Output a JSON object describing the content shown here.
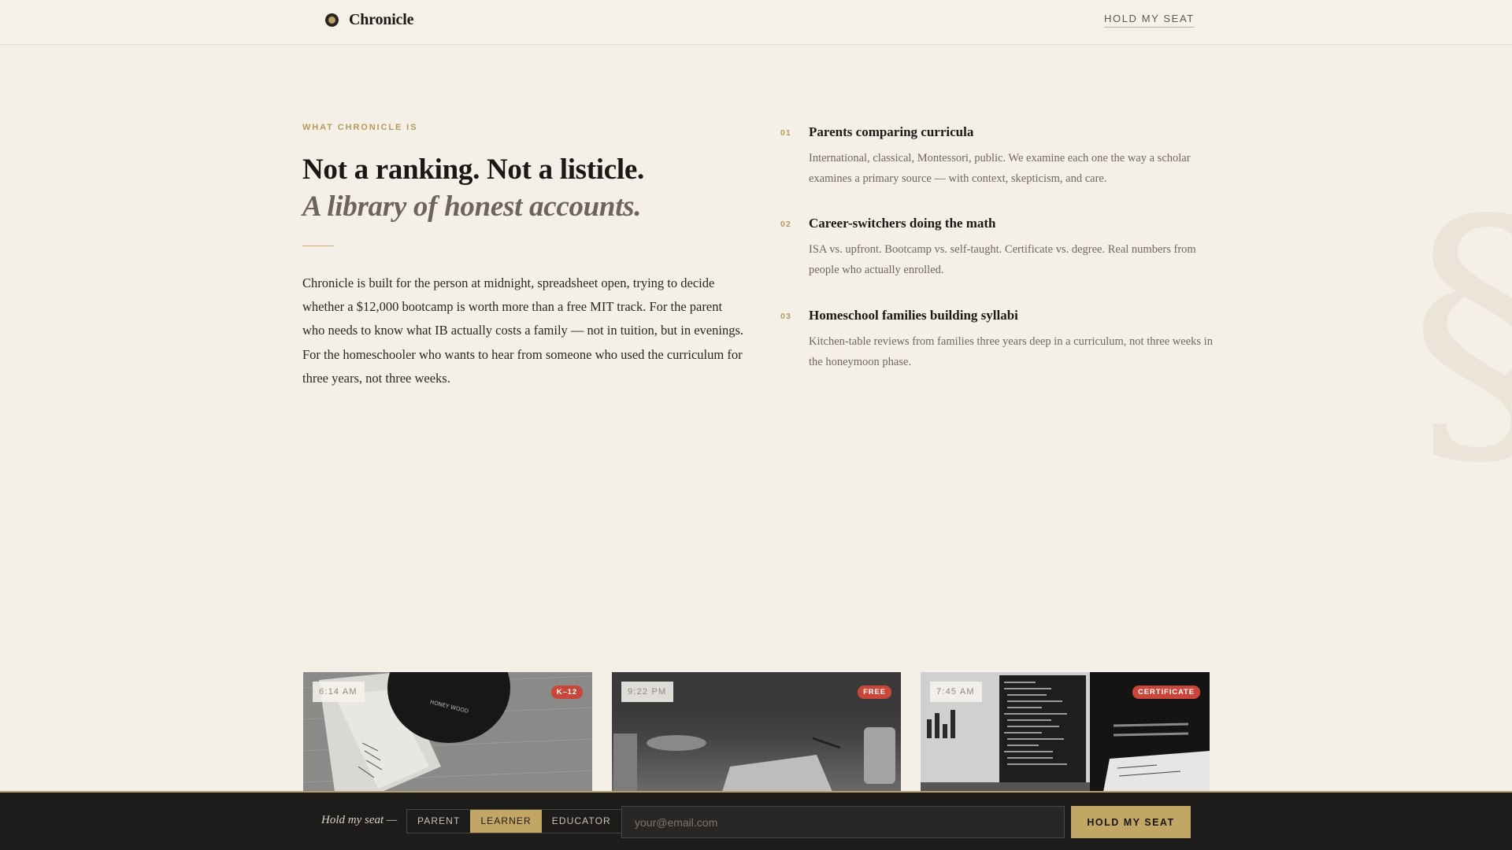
{
  "header": {
    "brand_name": "Chronicle",
    "cta_label": "HOLD MY SEAT"
  },
  "intro": {
    "eyebrow": "WHAT CHRONICLE IS",
    "title": "Not a ranking. Not a listicle.",
    "subtitle": "A library of honest accounts.",
    "body": "Chronicle is built for the person at midnight, spreadsheet open, trying to decide whether a $12,000 bootcamp is worth more than a free MIT track. For the parent who needs to know what IB actually costs a family — not in tuition, but in evenings. For the homeschooler who wants to hear from someone who used the curriculum for three years, not three weeks."
  },
  "audiences": [
    {
      "number": "01",
      "title": "Parents comparing curricula",
      "description": "International, classical, Montessori, public. We examine each one the way a scholar examines a primary source — with context, skepticism, and care."
    },
    {
      "number": "02",
      "title": "Career-switchers doing the math",
      "description": "ISA vs. upfront. Bootcamp vs. self-taught. Certificate vs. degree. Real numbers from people who actually enrolled."
    },
    {
      "number": "03",
      "title": "Homeschool families building syllabi",
      "description": "Kitchen-table reviews from families three years deep in a curriculum, not three weeks in the honeymoon phase."
    }
  ],
  "cards": [
    {
      "time": "6:14 AM",
      "tag": "K–12"
    },
    {
      "time": "9:22 PM",
      "tag": "FREE"
    },
    {
      "time": "7:45 AM",
      "tag": "CERTIFICATE"
    }
  ],
  "signup": {
    "label": "Hold my seat —",
    "roles": [
      "PARENT",
      "LEARNER",
      "EDUCATOR"
    ],
    "selected_role": "LEARNER",
    "email_placeholder": "your@email.com",
    "email_value": "",
    "submit_label": "HOLD MY SEAT"
  },
  "colors": {
    "background": "#f4efe7",
    "accent_gold": "#c2a666",
    "tag_red": "#c9473a",
    "bar_dark": "#1d1c1a"
  }
}
